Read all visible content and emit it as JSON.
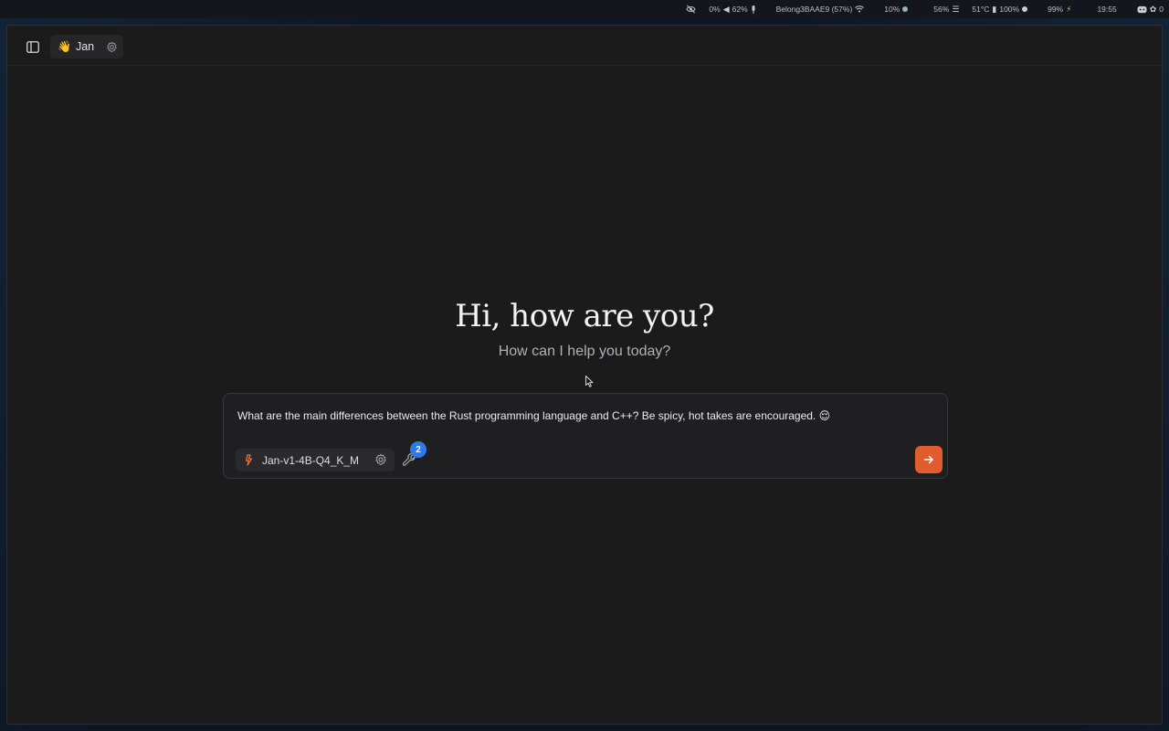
{
  "statusbar": {
    "visibility_icon": "eye-off-icon",
    "cpu": "0%",
    "volume": "62%",
    "mic_icon": "mic-icon",
    "network": "Belong3BAAE9 (57%)",
    "wifi_icon": "wifi-icon",
    "gpu": "10%",
    "memory": "56%",
    "temp": "51°C",
    "brightness": "100%",
    "battery": "99%",
    "time": "19:55",
    "discord_icon": "discord-icon",
    "tray_count": "0"
  },
  "topbar": {
    "assistant_emoji": "👋",
    "assistant_name": "Jan"
  },
  "hero": {
    "title": "Hi, how are you?",
    "subtitle": "How can I help you today?"
  },
  "composer": {
    "text": "What are the main differences between the Rust programming language and C++? Be spicy, hot takes are encouraged. 😌",
    "model_name": "Jan-v1-4B-Q4_K_M",
    "tools_count": "2"
  },
  "colors": {
    "accent": "#e15d2f",
    "badge": "#2d7be6",
    "window_bg": "#1c1b1c"
  }
}
